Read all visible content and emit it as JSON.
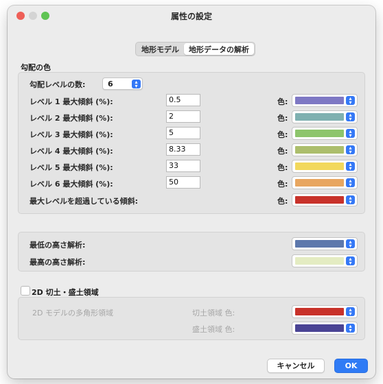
{
  "window": {
    "title": "属性の設定"
  },
  "tabs": [
    {
      "label": "地形モデル"
    },
    {
      "label": "地形データの解析"
    }
  ],
  "slope": {
    "section_title": "勾配の色",
    "level_count_label": "勾配レベルの数:",
    "level_count_value": "6",
    "color_label": "色:",
    "levels": [
      {
        "label": "レベル 1 最大傾斜 (%):",
        "value": "0.5",
        "color": "#7e78c4"
      },
      {
        "label": "レベル 2 最大傾斜 (%):",
        "value": "2",
        "color": "#7fb0b0"
      },
      {
        "label": "レベル 3 最大傾斜 (%):",
        "value": "5",
        "color": "#8dc56c"
      },
      {
        "label": "レベル 4 最大傾斜 (%):",
        "value": "8.33",
        "color": "#acbe6c"
      },
      {
        "label": "レベル 5 最大傾斜 (%):",
        "value": "33",
        "color": "#f2d85c"
      },
      {
        "label": "レベル 6 最大傾斜 (%):",
        "value": "50",
        "color": "#e8a660"
      }
    ],
    "over_label": "最大レベルを超過している傾斜:",
    "over_color": "#c8322a"
  },
  "height": {
    "min_label": "最低の高さ解析:",
    "min_color": "#5d78ac",
    "max_label": "最高の高さ解析:",
    "max_color": "#e4ecc2"
  },
  "cutfill": {
    "checkbox_label": "2D 切土・盛土領域",
    "polygon_label": "2D モデルの多角形領域",
    "cut_label": "切土領域 色:",
    "cut_color": "#c8322a",
    "fill_label": "盛土領域 色:",
    "fill_color": "#4a4494"
  },
  "buttons": {
    "cancel": "キャンセル",
    "ok": "OK"
  }
}
